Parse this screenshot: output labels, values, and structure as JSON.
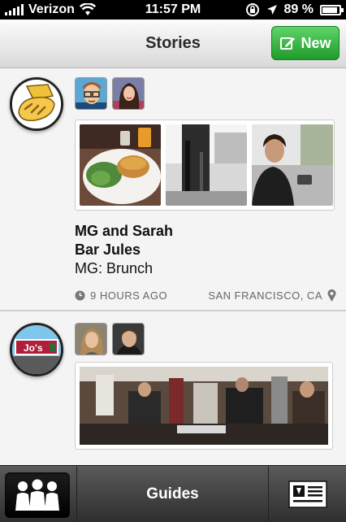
{
  "status_bar": {
    "carrier": "Verizon",
    "time": "11:57 PM",
    "battery": "89 %",
    "battery_level": 0.89
  },
  "nav_bar": {
    "title": "Stories",
    "new_button": "New"
  },
  "stories": [
    {
      "venue_icon": "bread-icon",
      "line1": "MG and Sarah",
      "line2": "Bar Jules",
      "line3": "MG: Brunch",
      "time_ago": "9 HOURS AGO",
      "location": "SAN FRANCISCO, CA"
    },
    {
      "venue_icon": "jos-sign-icon",
      "sign_text": "Jo's"
    }
  ],
  "tab_bar": {
    "guides_label": "Guides"
  },
  "icons": {
    "people": "people-icon",
    "newspaper": "newspaper-icon",
    "clock": "clock-icon",
    "location_pin": "location-pin-icon"
  },
  "colors": {
    "new_button": "#2fb03a",
    "tab_bar": "#3a3a3a"
  }
}
